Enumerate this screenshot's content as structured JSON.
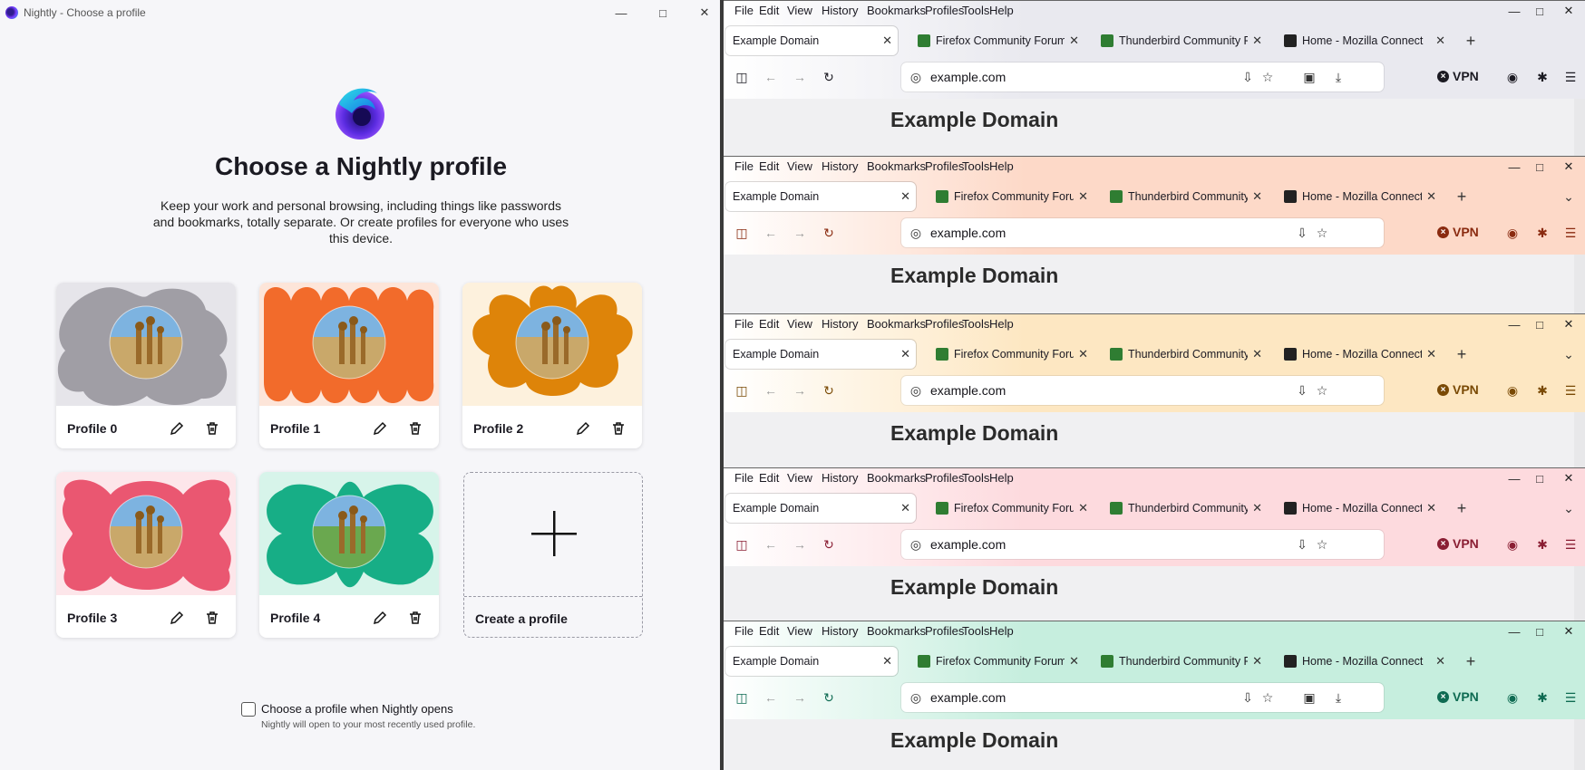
{
  "picker": {
    "window_title": "Nightly - Choose a profile",
    "heading": "Choose a Nightly profile",
    "subtitle": "Keep your work and personal browsing, including things like passwords and bookmarks, totally separate. Or create profiles for everyone who uses this device.",
    "profiles": [
      {
        "name": "Profile 0",
        "color": "#a09ea5",
        "bg": "#e6e5ea"
      },
      {
        "name": "Profile 1",
        "color": "#f26b2b",
        "bg": "#fde5d9"
      },
      {
        "name": "Profile 2",
        "color": "#de8409",
        "bg": "#fdf1dd"
      },
      {
        "name": "Profile 3",
        "color": "#ea5771",
        "bg": "#fde6ea"
      },
      {
        "name": "Profile 4",
        "color": "#17ae86",
        "bg": "#d7f4ea"
      }
    ],
    "create_label": "Create a profile",
    "checkbox_label": "Choose a profile when Nightly opens",
    "checkbox_help": "Nightly will open to your most recently used profile.",
    "checkbox_checked": false
  },
  "menus": [
    "File",
    "Edit",
    "View",
    "History",
    "Bookmarks",
    "Profiles",
    "Tools",
    "Help"
  ],
  "tabs": {
    "active": "Example Domain",
    "others": [
      "Firefox Community Forum | Mozilla Support",
      "Thunderbird Community Forum",
      "Home - Mozilla Connect"
    ]
  },
  "url": "example.com",
  "vpn_label": "VPN",
  "page_heading": "Example Domain",
  "windows": [
    {
      "theme": "#e9e9ef",
      "accent": "#1b1a22"
    },
    {
      "theme": "#fdd9c8",
      "accent": "#8a2b10"
    },
    {
      "theme": "#fde7c2",
      "accent": "#7a4a05"
    },
    {
      "theme": "#fddade",
      "accent": "#8a1e33"
    },
    {
      "theme": "#c6eede",
      "accent": "#0e6b52"
    }
  ]
}
